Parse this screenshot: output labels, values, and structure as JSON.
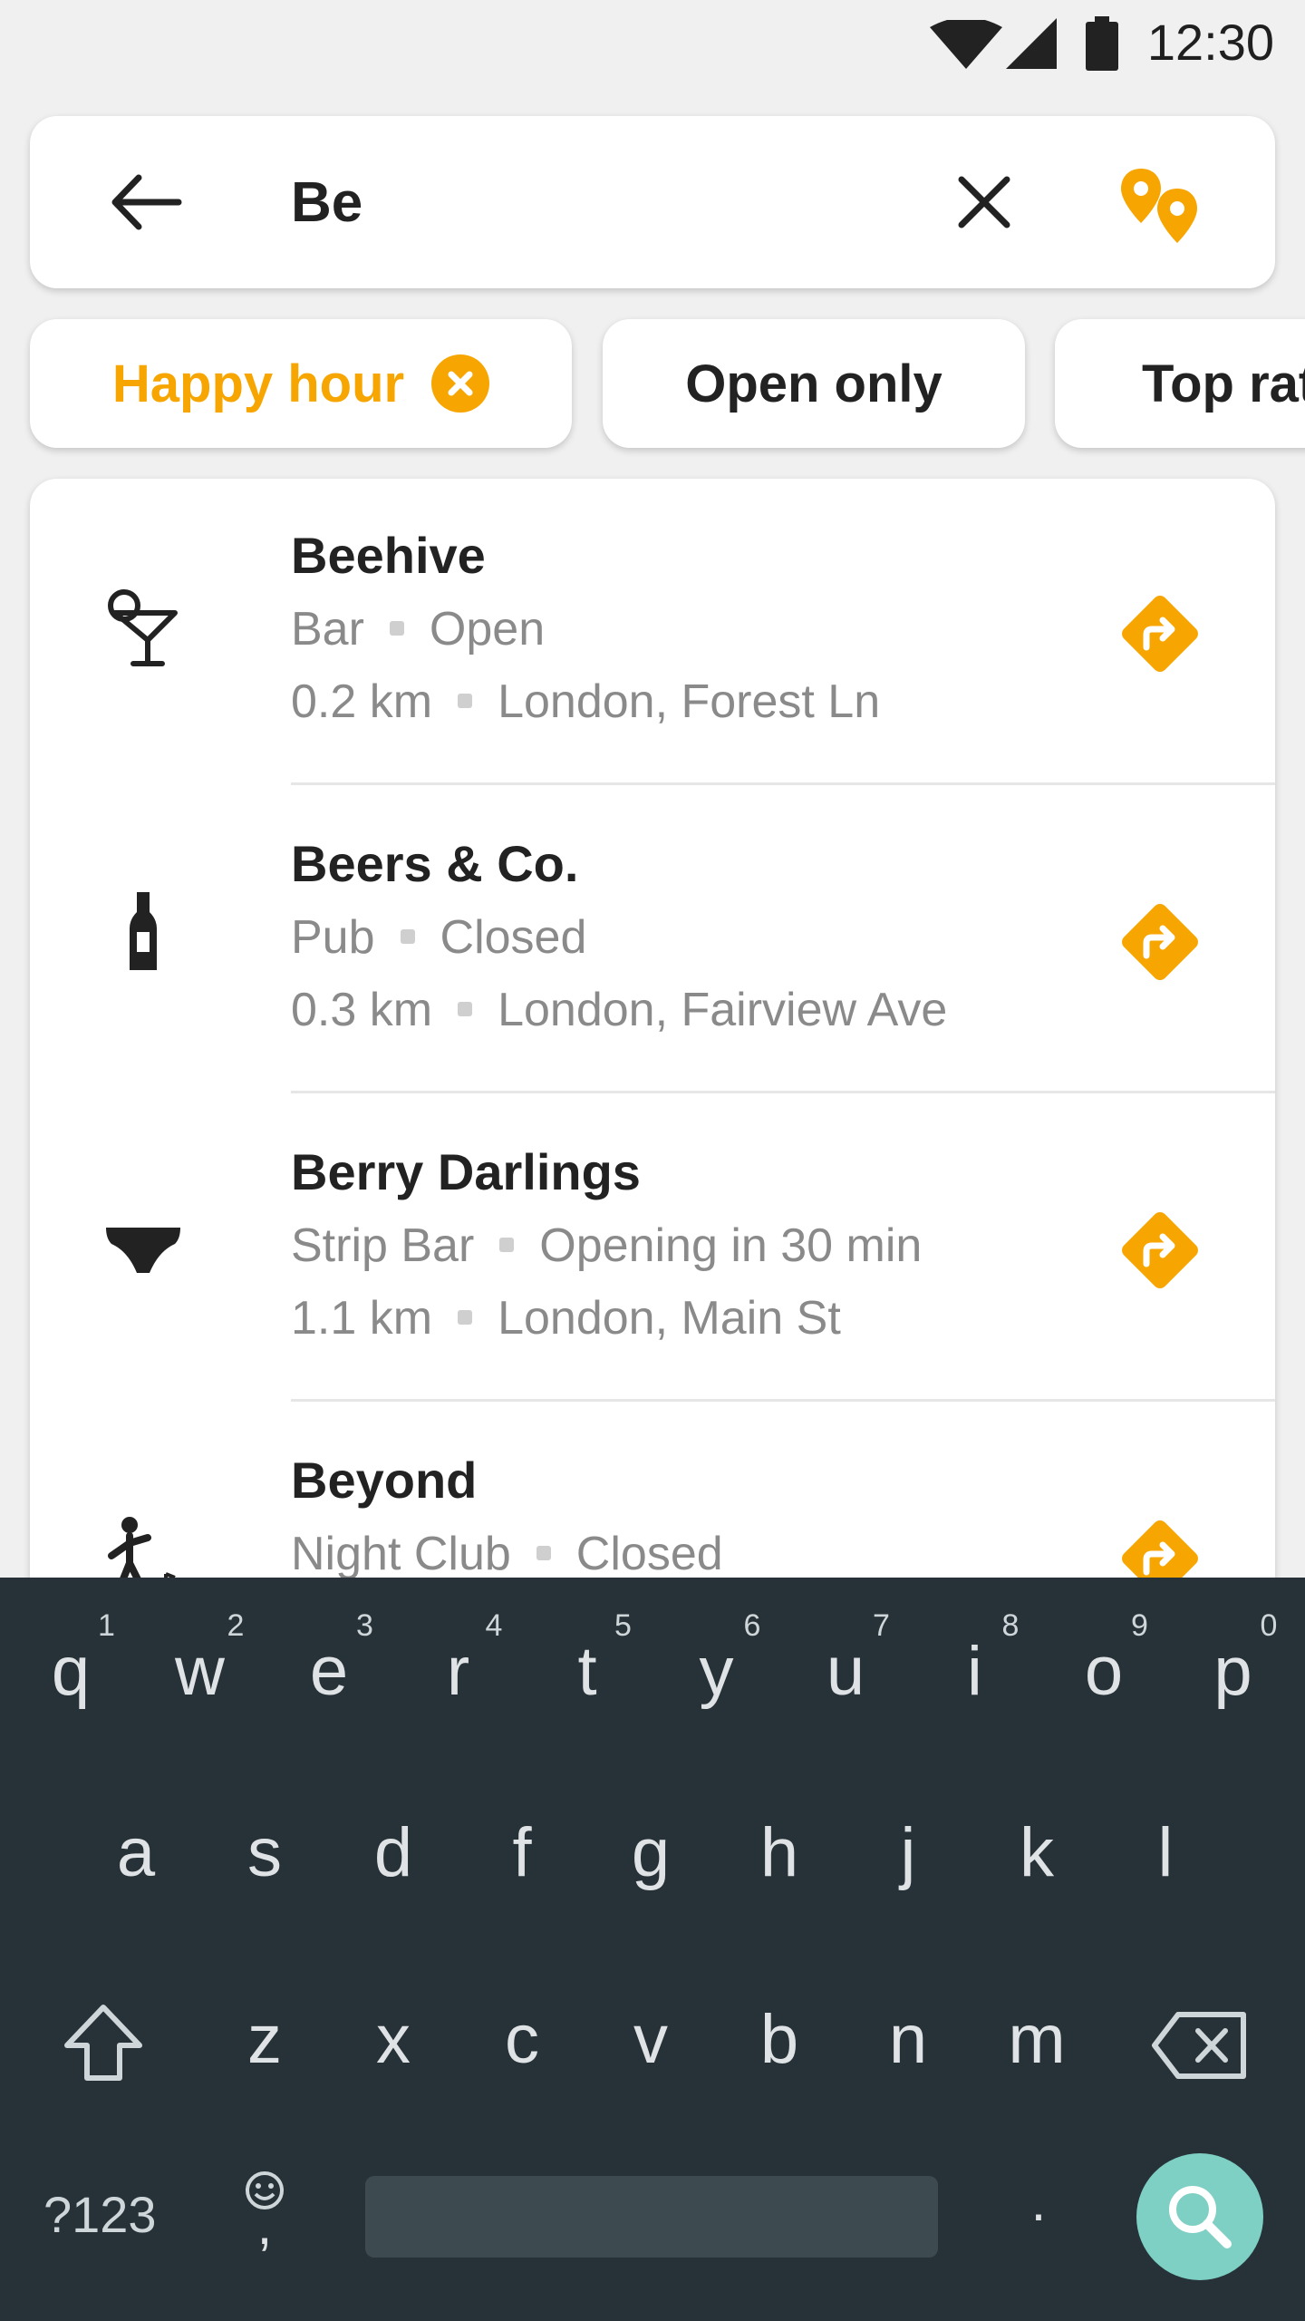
{
  "status_bar": {
    "time": "12:30"
  },
  "search": {
    "value": "Be"
  },
  "chips": [
    {
      "label": "Happy hour",
      "active": true
    },
    {
      "label": "Open only",
      "active": false
    },
    {
      "label": "Top rat",
      "active": false
    }
  ],
  "results": [
    {
      "name": "Beehive",
      "type": "Bar",
      "status": "Open",
      "distance": "0.2 km",
      "address": "London, Forest Ln",
      "icon": "cocktail-icon"
    },
    {
      "name": "Beers & Co.",
      "type": "Pub",
      "status": "Closed",
      "distance": "0.3 km",
      "address": "London, Fairview Ave",
      "icon": "beer-bottle-icon"
    },
    {
      "name": "Berry Darlings",
      "type": "Strip Bar",
      "status": "Opening in 30 min",
      "distance": "1.1 km",
      "address": "London, Main St",
      "icon": "underwear-icon"
    },
    {
      "name": "Beyond",
      "type": "Night Club",
      "status": "Closed",
      "distance": "",
      "address": "",
      "icon": "dancer-icon"
    }
  ],
  "keyboard": {
    "row1": [
      "q",
      "w",
      "e",
      "r",
      "t",
      "y",
      "u",
      "i",
      "o",
      "p"
    ],
    "row1_nums": [
      "1",
      "2",
      "3",
      "4",
      "5",
      "6",
      "7",
      "8",
      "9",
      "0"
    ],
    "row2": [
      "a",
      "s",
      "d",
      "f",
      "g",
      "h",
      "j",
      "k",
      "l"
    ],
    "row3": [
      "z",
      "x",
      "c",
      "v",
      "b",
      "n",
      "m"
    ],
    "symbols_label": "?123",
    "comma": ",",
    "period": "."
  },
  "colors": {
    "accent": "#f7a500",
    "keyboard_bg": "#263238",
    "search_key": "#7ecfc4"
  }
}
